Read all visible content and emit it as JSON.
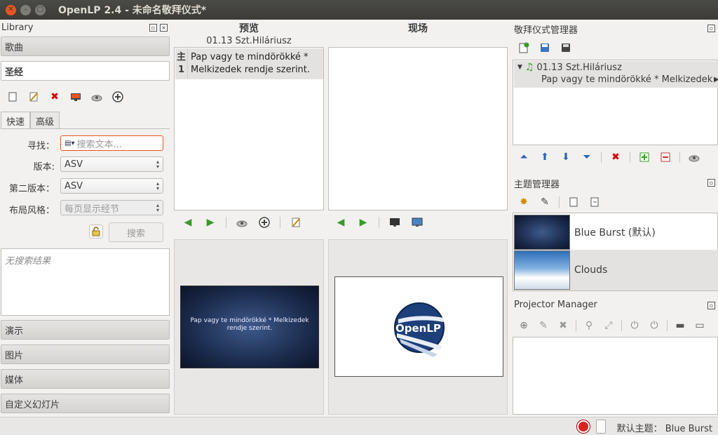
{
  "window": {
    "title": "OpenLP 2.4 - 未命名敬拜仪式*"
  },
  "library": {
    "title": "Library",
    "sections_top": [
      "歌曲",
      "圣经"
    ],
    "tabs": [
      "快速",
      "高级"
    ],
    "form": {
      "find_label": "寻找：",
      "search_placeholder": "搜索文本...",
      "version_label": "版本:",
      "version_value": "ASV",
      "second_version_label": "第二版本：",
      "second_version_value": "ASV",
      "layout_label": "布局风格：",
      "layout_value": "每页显示经节",
      "search_button": "搜索"
    },
    "no_results": "无搜索结果",
    "sections_bottom": [
      "演示",
      "图片",
      "媒体",
      "自定义幻灯片"
    ]
  },
  "preview": {
    "heading": "预览",
    "service_item": "01.13 Szt.Hiláriusz",
    "row_tag": "主\n1",
    "row_text": "Pap vagy te mindörökké * Melkizedek rendje szerint.",
    "slide_text": "Pap vagy te mindörökké * Melkizedek rendje szerint."
  },
  "live": {
    "heading": "现场",
    "logo_text": "OpenLP"
  },
  "service_manager": {
    "title": "敬拜仪式管理器",
    "item_title": "01.13 Szt.Hiláriusz",
    "item_sub": "Pap vagy te mindörökké * Melkizedek"
  },
  "theme_manager": {
    "title": "主题管理器",
    "themes": [
      "Blue Burst (默认)",
      "Clouds"
    ]
  },
  "projector_manager": {
    "title": "Projector Manager"
  },
  "status": {
    "default_theme_label": "默认主题：",
    "default_theme_value": "Blue Burst"
  },
  "colors": {
    "accent": "#e95420",
    "titlebar": "#3c3b37"
  }
}
